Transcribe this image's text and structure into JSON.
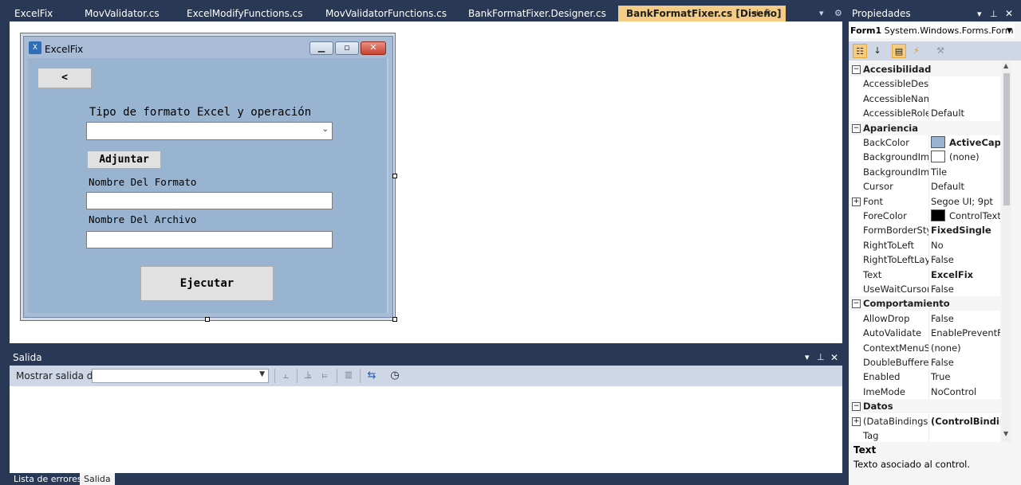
{
  "document_tabs": [
    {
      "label": "ExcelFix",
      "active": false
    },
    {
      "label": "MovValidator.cs",
      "active": false
    },
    {
      "label": "ExcelModifyFunctions.cs",
      "active": false
    },
    {
      "label": "MovValidatorFunctions.cs",
      "active": false
    },
    {
      "label": "BankFormatFixer.Designer.cs",
      "active": false
    },
    {
      "label": "BankFormatFixer.cs [Diseño]",
      "active": true
    }
  ],
  "designer_form": {
    "title": "ExcelFix",
    "back_button": "<",
    "label_type": "Tipo de formato Excel y operación",
    "type_combo_value": "",
    "attach_button": "Adjuntar",
    "label_format_name": "Nombre Del Formato",
    "format_name_value": "",
    "label_file_name": "Nombre Del Archivo",
    "file_name_value": "",
    "execute_button": "Ejecutar"
  },
  "output_panel": {
    "title": "Salida",
    "show_output_label": "Mostrar salida de:",
    "show_output_value": ""
  },
  "bottom_tabs": [
    {
      "label": "Lista de errores",
      "active": false
    },
    {
      "label": "Salida",
      "active": true
    }
  ],
  "properties": {
    "title": "Propiedades",
    "object_name": "Form1",
    "object_type": "System.Windows.Forms.Form",
    "rows": [
      {
        "kind": "cat",
        "name": "Accesibilidad"
      },
      {
        "kind": "prop",
        "name": "AccessibleDescription",
        "value": ""
      },
      {
        "kind": "prop",
        "name": "AccessibleName",
        "value": ""
      },
      {
        "kind": "prop",
        "name": "AccessibleRole",
        "value": "Default"
      },
      {
        "kind": "cat",
        "name": "Apariencia"
      },
      {
        "kind": "prop",
        "name": "BackColor",
        "value": "ActiveCaption",
        "swatch": "#99b4d1",
        "bold": true
      },
      {
        "kind": "prop",
        "name": "BackgroundImage",
        "value": "(none)",
        "swatch": "#ffffff"
      },
      {
        "kind": "prop",
        "name": "BackgroundImageLayout",
        "value": "Tile"
      },
      {
        "kind": "prop",
        "name": "Cursor",
        "value": "Default"
      },
      {
        "kind": "prop",
        "name": "Font",
        "value": "Segoe UI; 9pt",
        "expandable": true
      },
      {
        "kind": "prop",
        "name": "ForeColor",
        "value": "ControlText",
        "swatch": "#000000"
      },
      {
        "kind": "prop",
        "name": "FormBorderStyle",
        "value": "FixedSingle",
        "bold": true
      },
      {
        "kind": "prop",
        "name": "RightToLeft",
        "value": "No"
      },
      {
        "kind": "prop",
        "name": "RightToLeftLayout",
        "value": "False"
      },
      {
        "kind": "prop",
        "name": "Text",
        "value": "ExcelFix",
        "bold": true
      },
      {
        "kind": "prop",
        "name": "UseWaitCursor",
        "value": "False"
      },
      {
        "kind": "cat",
        "name": "Comportamiento"
      },
      {
        "kind": "prop",
        "name": "AllowDrop",
        "value": "False"
      },
      {
        "kind": "prop",
        "name": "AutoValidate",
        "value": "EnablePreventFocusChange"
      },
      {
        "kind": "prop",
        "name": "ContextMenuStrip",
        "value": "(none)"
      },
      {
        "kind": "prop",
        "name": "DoubleBuffered",
        "value": "False"
      },
      {
        "kind": "prop",
        "name": "Enabled",
        "value": "True"
      },
      {
        "kind": "prop",
        "name": "ImeMode",
        "value": "NoControl"
      },
      {
        "kind": "cat",
        "name": "Datos"
      },
      {
        "kind": "prop",
        "name": "(DataBindings)",
        "value": "(ControlBindings)",
        "bold": true,
        "expandable": true
      },
      {
        "kind": "prop",
        "name": "Tag",
        "value": ""
      }
    ],
    "description_title": "Text",
    "description_text": "Texto asociado al control."
  },
  "colors": {
    "ide_frame": "#293955",
    "active_tab": "#F5CC84",
    "form_client": "#99b4d1",
    "toolbar": "#cfd6e5"
  }
}
